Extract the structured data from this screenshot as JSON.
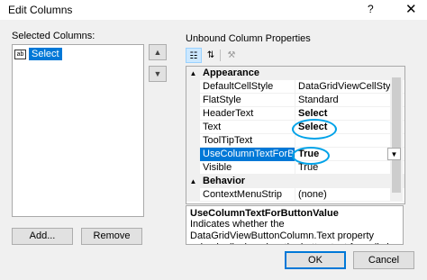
{
  "window": {
    "title": "Edit Columns",
    "help_glyph": "?",
    "close_glyph": "✕"
  },
  "left": {
    "label": "Selected Columns:",
    "items": [
      {
        "icon": "ab",
        "label": "Select"
      }
    ],
    "add_label": "Add...",
    "remove_label": "Remove"
  },
  "right": {
    "label": "Unbound Column Properties",
    "toolbar": {
      "categorized_icon": "categorized-icon",
      "alphabetical_icon": "alphabetical-icon",
      "property_pages_icon": "wrench-icon"
    },
    "categories": [
      {
        "name": "Appearance",
        "glyph": "▲"
      },
      {
        "name": "Behavior",
        "glyph": "▲"
      }
    ],
    "properties": [
      {
        "name": "DefaultCellStyle",
        "value": "DataGridViewCellStyle { Alig"
      },
      {
        "name": "FlatStyle",
        "value": "Standard"
      },
      {
        "name": "HeaderText",
        "value": "Select"
      },
      {
        "name": "Text",
        "value": "Select"
      },
      {
        "name": "ToolTipText",
        "value": ""
      },
      {
        "name": "UseColumnTextForButt",
        "value": "True"
      },
      {
        "name": "Visible",
        "value": "True"
      },
      {
        "name": "ContextMenuStrip",
        "value": "(none)"
      }
    ],
    "description": {
      "title": "UseColumnTextForButtonValue",
      "text": "Indicates whether the DataGridViewButtonColumn.Text property value is displayed as the button text for cells in"
    }
  },
  "footer": {
    "ok_label": "OK",
    "cancel_label": "Cancel"
  },
  "colors": {
    "selection": "#0078d7",
    "annotation": "#00a2e8"
  }
}
